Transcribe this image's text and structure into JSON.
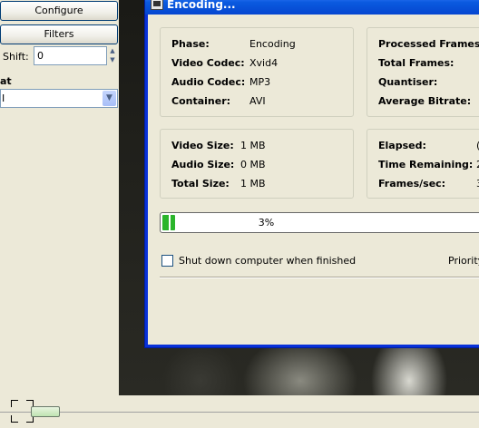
{
  "left_panel": {
    "configure_label": "Configure",
    "filters_label": "Filters",
    "shift_label": "Shift:",
    "shift_value": "0",
    "format_label": "at",
    "format_value": "I"
  },
  "dialog": {
    "title": "Encoding...",
    "info_left": [
      {
        "label": "Phase:",
        "value": "Encoding"
      },
      {
        "label": "Video Codec:",
        "value": "Xvid4"
      },
      {
        "label": "Audio Codec:",
        "value": "MP3"
      },
      {
        "label": "Container:",
        "value": "AVI"
      }
    ],
    "info_right": [
      {
        "label": "Processed Frames:",
        "value": ""
      },
      {
        "label": "Total Frames:",
        "value": ""
      },
      {
        "label": "Quantiser:",
        "value": ""
      },
      {
        "label": "Average Bitrate:",
        "value": ""
      }
    ],
    "size_left": [
      {
        "label": "Video Size:",
        "value": "1 MB"
      },
      {
        "label": "Audio Size:",
        "value": "0 MB"
      },
      {
        "label": "Total Size:",
        "value": "1 MB"
      }
    ],
    "size_right": [
      {
        "label": "Elapsed:",
        "value": "("
      },
      {
        "label": "Time Remaining:",
        "value": "2"
      },
      {
        "label": "Frames/sec:",
        "value": "3"
      }
    ],
    "progress_percent": 3,
    "progress_text": "3%",
    "shutdown_label": "Shut down computer when finished",
    "shutdown_checked": false,
    "priority_label": "Priority"
  },
  "colors": {
    "title_bar": "#0a5adf",
    "progress_green": "#2bb52b",
    "dialog_bg": "#ece9d8"
  }
}
